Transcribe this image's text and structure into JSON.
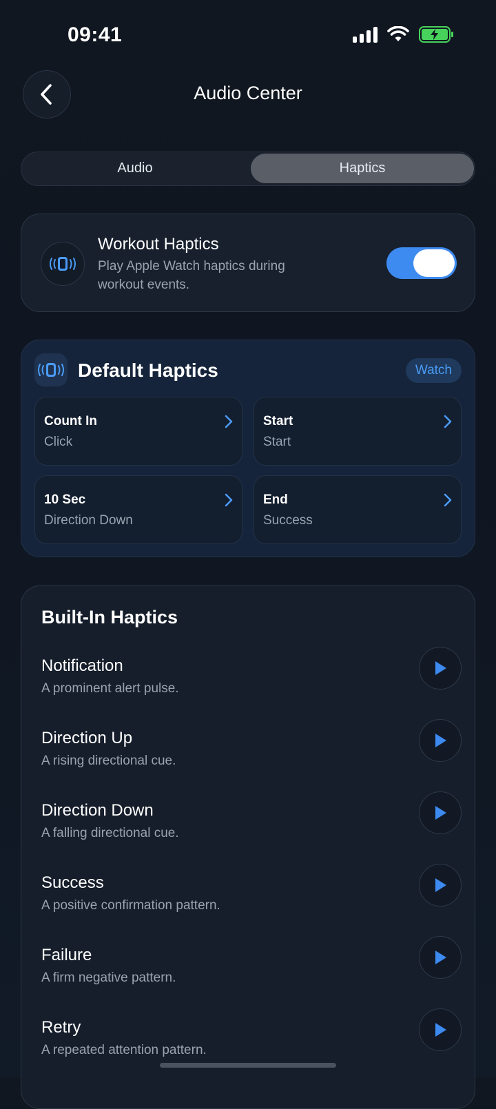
{
  "status_bar": {
    "time": "09:41"
  },
  "header": {
    "title": "Audio Center"
  },
  "segmented": {
    "options": [
      "Audio",
      "Haptics"
    ],
    "selected": "Haptics"
  },
  "workout_haptics": {
    "title": "Workout Haptics",
    "description": "Play Apple Watch haptics during workout events.",
    "enabled": true
  },
  "default_haptics": {
    "title": "Default Haptics",
    "badge": "Watch",
    "items": [
      {
        "label": "Count In",
        "value": "Click"
      },
      {
        "label": "Start",
        "value": "Start"
      },
      {
        "label": "10 Sec",
        "value": "Direction Down"
      },
      {
        "label": "End",
        "value": "Success"
      }
    ]
  },
  "built_in": {
    "title": "Built-In Haptics",
    "items": [
      {
        "title": "Notification",
        "desc": "A prominent alert pulse."
      },
      {
        "title": "Direction Up",
        "desc": "A rising directional cue."
      },
      {
        "title": "Direction Down",
        "desc": "A falling directional cue."
      },
      {
        "title": "Success",
        "desc": "A positive confirmation pattern."
      },
      {
        "title": "Failure",
        "desc": "A firm negative pattern."
      },
      {
        "title": "Retry",
        "desc": "A repeated attention pattern."
      }
    ]
  },
  "colors": {
    "accent": "#3d8af0",
    "battery": "#47d25c",
    "badge_text": "#4b9bf5"
  }
}
